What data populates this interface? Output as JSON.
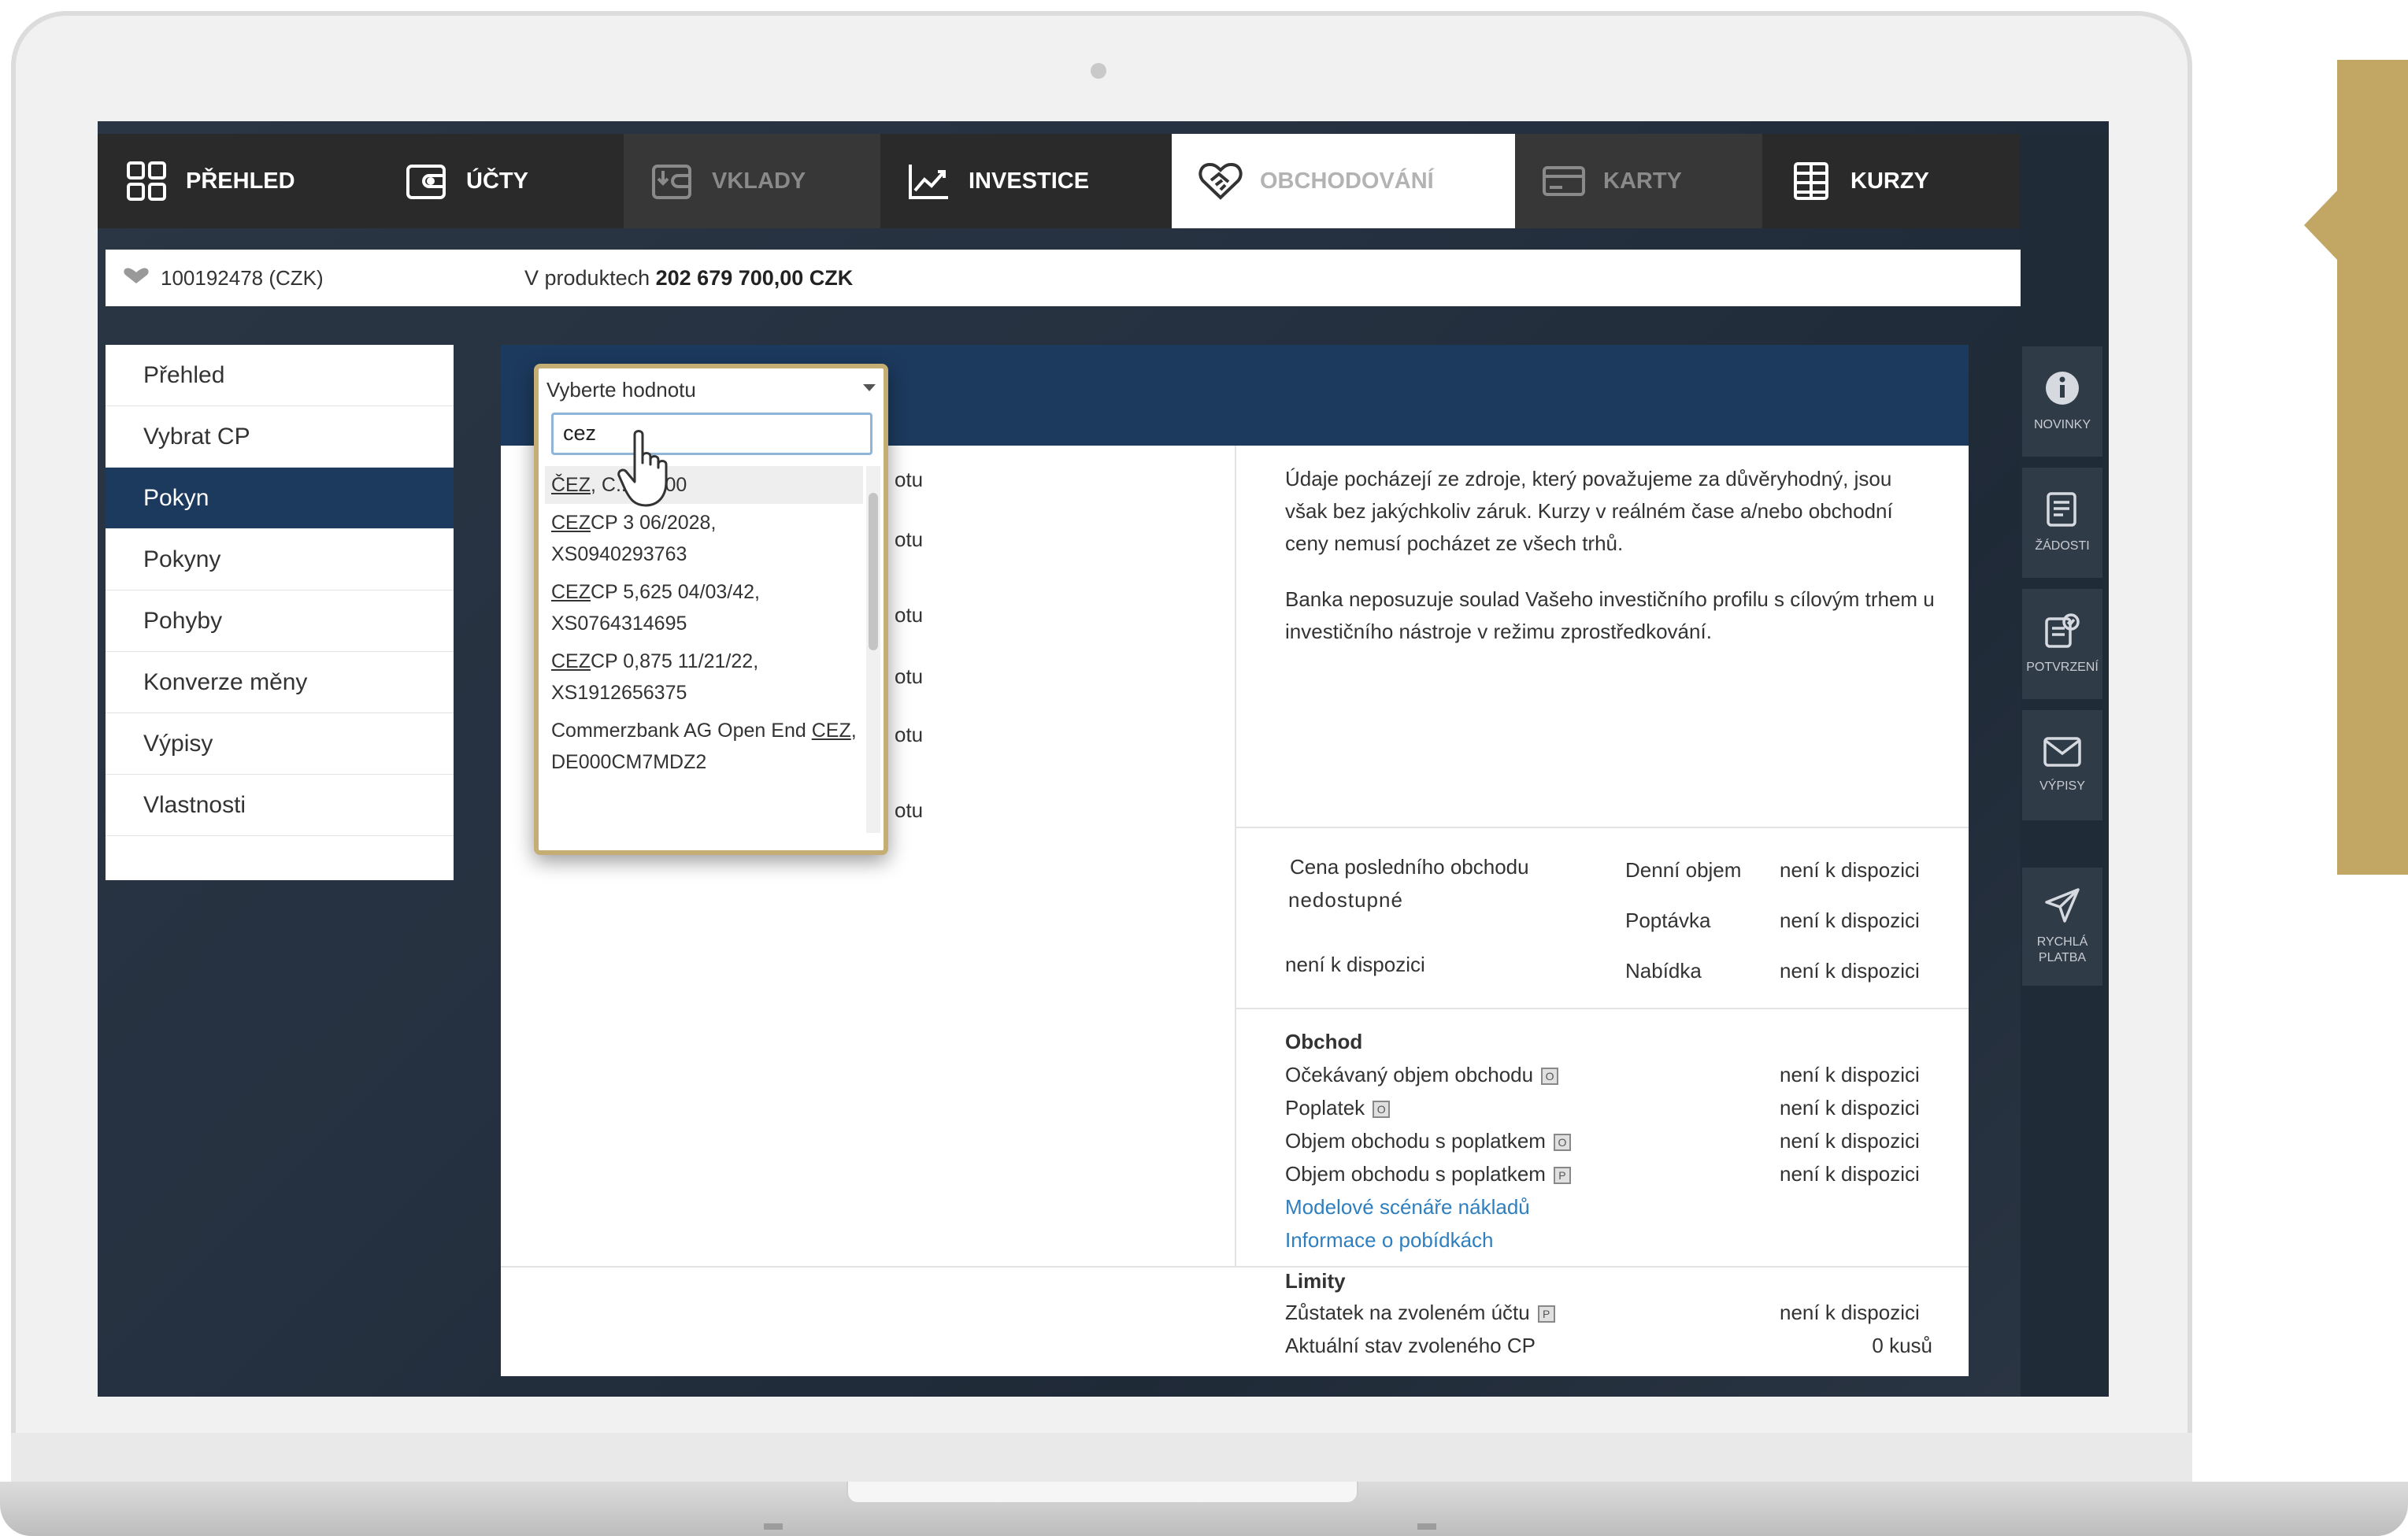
{
  "nav": {
    "items": [
      {
        "label": "PŘEHLED",
        "icon": "grid-icon",
        "state": "normal"
      },
      {
        "label": "ÚČTY",
        "icon": "wallet-icon",
        "state": "normal"
      },
      {
        "label": "VKLADY",
        "icon": "deposit-icon",
        "state": "dim"
      },
      {
        "label": "INVESTICE",
        "icon": "chart-icon",
        "state": "normal"
      },
      {
        "label": "OBCHODOVÁNÍ",
        "icon": "handshake-icon",
        "state": "active"
      },
      {
        "label": "KARTY",
        "icon": "card-icon",
        "state": "dim"
      },
      {
        "label": "KURZY",
        "icon": "table-icon",
        "state": "normal"
      }
    ]
  },
  "infobar": {
    "account": "100192478 (CZK)",
    "in_products_label": "V produktech",
    "in_products_value": "202 679 700,00 CZK"
  },
  "left_menu": {
    "items": [
      "Přehled",
      "Vybrat CP",
      "Pokyn",
      "Pokyny",
      "Pohyby",
      "Konverze měny",
      "Výpisy",
      "Vlastnosti"
    ],
    "active": "Pokyn"
  },
  "side_buttons": [
    {
      "label": "NOVINKY",
      "icon": "info-icon"
    },
    {
      "label": "ŽÁDOSTI",
      "icon": "request-icon"
    },
    {
      "label": "POTVRZENÍ",
      "icon": "confirm-icon"
    },
    {
      "label": "VÝPISY",
      "icon": "mail-icon"
    },
    {
      "label": "RYCHLÁ PLATBA",
      "icon": "send-icon"
    }
  ],
  "dropdown": {
    "placeholder": "Vyberte hodnotu",
    "search_value": "cez",
    "options": [
      {
        "match": "ČEZ",
        "rest": ", C...12300"
      },
      {
        "match": "CEZ",
        "rest": "CP 3 06/2028, XS0940293763"
      },
      {
        "match": "CEZ",
        "rest": "CP 5,625 04/03/42, XS0764314695"
      },
      {
        "match": "CEZ",
        "rest": "CP 0,875 11/21/22, XS1912656375"
      },
      {
        "prefix": "Commerzbank AG Open End ",
        "match": "CEZ",
        "rest": ", DE000CM7MDZ2"
      }
    ]
  },
  "left_col_fragment": "otu",
  "disclaimer": {
    "p1": "Údaje pocházejí ze zdroje, který považujeme za důvěryhodný, jsou však bez jakýchkoliv záruk. Kurzy v reálném čase a/nebo obchodní ceny nemusí pocházet ze všech trhů.",
    "p2": "Banka neposuzuje soulad Vašeho investičního profilu s cílovým trhem u investičního nástroje v režimu zprostředkování."
  },
  "quote": {
    "last_price_label": "Cena posledního obchodu",
    "last_price_value": "nedostupné",
    "last_price_sub": "není k dispozici",
    "rows": [
      {
        "label": "Denní objem",
        "value": "není k dispozici"
      },
      {
        "label": "Poptávka",
        "value": "není k dispozici"
      },
      {
        "label": "Nabídka",
        "value": "není k dispozici"
      }
    ]
  },
  "trade": {
    "title": "Obchod",
    "rows": [
      {
        "label": "Očekávaný objem obchodu",
        "badge": "O",
        "value": "není k dispozici"
      },
      {
        "label": "Poplatek",
        "badge": "O",
        "value": "není k dispozici"
      },
      {
        "label": "Objem obchodu s poplatkem",
        "badge": "O",
        "value": "není k dispozici"
      },
      {
        "label": "Objem obchodu s poplatkem",
        "badge": "P",
        "value": "není k dispozici"
      }
    ],
    "link1": "Modelové scénáře nákladů",
    "link2": "Informace o pobídkách"
  },
  "limits": {
    "title": "Limity",
    "rows": [
      {
        "label": "Zůstatek na zvoleném účtu",
        "badge": "P",
        "value": "není k dispozici"
      },
      {
        "label": "Aktuální stav zvoleného CP",
        "value": "0 kusů"
      }
    ]
  }
}
